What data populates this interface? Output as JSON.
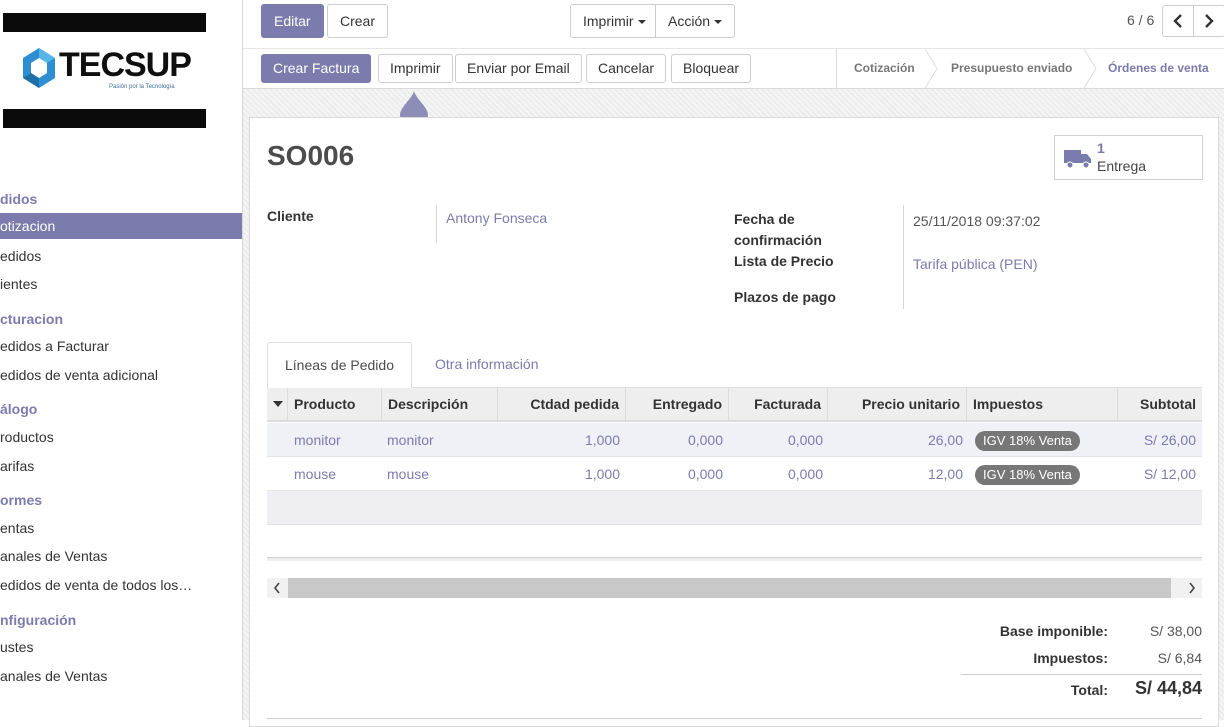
{
  "sidebar": {
    "logo": {
      "wordmark": "TECSUP",
      "tagline": "Pasión por la Tecnología"
    },
    "sections": [
      {
        "label": "didos",
        "items": [
          {
            "label": "otizacion",
            "active": true
          },
          {
            "label": "edidos",
            "active": false
          },
          {
            "label": "ientes",
            "active": false
          }
        ]
      },
      {
        "label": "cturacion",
        "items": [
          {
            "label": "edidos a Facturar",
            "active": false
          },
          {
            "label": "edidos de venta adicional",
            "active": false
          }
        ]
      },
      {
        "label": "álogo",
        "items": [
          {
            "label": "roductos",
            "active": false
          },
          {
            "label": "arifas",
            "active": false
          }
        ]
      },
      {
        "label": "ormes",
        "items": [
          {
            "label": "entas",
            "active": false
          },
          {
            "label": "anales de Ventas",
            "active": false
          },
          {
            "label": "edidos de venta de todos los…",
            "active": false
          }
        ]
      },
      {
        "label": "nfiguración",
        "items": [
          {
            "label": "ustes",
            "active": false
          },
          {
            "label": "anales de Ventas",
            "active": false
          }
        ]
      }
    ]
  },
  "toolbar": {
    "edit_label": "Editar",
    "create_label": "Crear",
    "print_label": "Imprimir",
    "action_label": "Acción",
    "pager_value": "6 / 6",
    "prev_icon": "chevron-left-icon",
    "next_icon": "chevron-right-icon"
  },
  "header_buttons": {
    "create_invoice": "Crear Factura",
    "print": "Imprimir",
    "send_email": "Enviar por Email",
    "cancel": "Cancelar",
    "lock": "Bloquear"
  },
  "statusbar": {
    "stages": [
      "Cotización",
      "Presupuesto enviado",
      "Órdenes de venta"
    ],
    "current_index": 2
  },
  "form": {
    "name": "SO006",
    "smart_button": {
      "icon": "truck-icon",
      "count": "1",
      "label": "Entrega"
    },
    "customer_label": "Cliente",
    "customer_value": "Antony Fonseca",
    "confirmation_date_label": "Fecha de confirmación",
    "confirmation_date_value": "25/11/2018 09:37:02",
    "pricelist_label": "Lista de Precio",
    "pricelist_value": "Tarifa pública (PEN)",
    "payment_terms_label": "Plazos de pago",
    "payment_terms_value": ""
  },
  "tabs": [
    "Líneas de Pedido",
    "Otra información"
  ],
  "order_lines": {
    "columns": [
      "Producto",
      "Descripción",
      "Ctdad pedida",
      "Entregado",
      "Facturada",
      "Precio unitario",
      "Impuestos",
      "Subtotal"
    ],
    "rows": [
      {
        "product": "monitor",
        "description": "monitor",
        "qty": "1,000",
        "delivered": "0,000",
        "invoiced": "0,000",
        "price": "26,00",
        "tax": "IGV 18% Venta",
        "subtotal": "S/ 26,00"
      },
      {
        "product": "mouse",
        "description": "mouse",
        "qty": "1,000",
        "delivered": "0,000",
        "invoiced": "0,000",
        "price": "12,00",
        "tax": "IGV 18% Venta",
        "subtotal": "S/ 12,00"
      }
    ]
  },
  "totals": {
    "untaxed_label": "Base imponible:",
    "untaxed_value": "S/ 38,00",
    "taxes_label": "Impuestos:",
    "taxes_value": "S/ 6,84",
    "total_label": "Total:",
    "total_value": "S/ 44,84"
  },
  "colors": {
    "accent": "#7c7bad",
    "badge": "#777777",
    "sheet_bg": "#f1f1f1"
  }
}
